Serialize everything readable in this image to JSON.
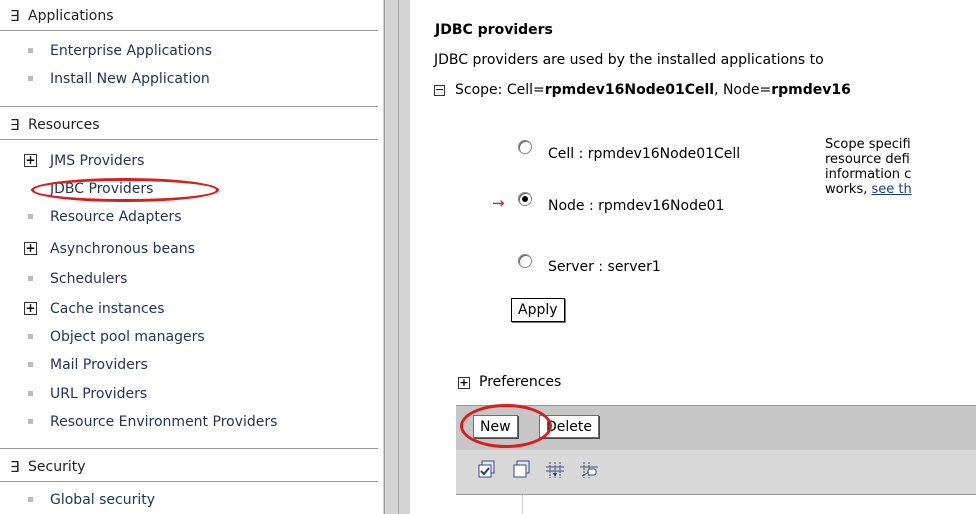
{
  "nav": {
    "sections": [
      {
        "label": "Applications",
        "expanded_glyph": "∃"
      },
      {
        "label": "Resources",
        "expanded_glyph": "∃"
      },
      {
        "label": "Security",
        "expanded_glyph": "∃"
      }
    ],
    "applications_items": [
      "Enterprise Applications",
      "Install New Application"
    ],
    "resources_items": [
      "JMS Providers",
      "JDBC Providers",
      "Resource Adapters",
      "Asynchronous beans",
      "Schedulers",
      "Cache instances",
      "Object pool managers",
      "Mail Providers",
      "URL Providers",
      "Resource Environment Providers"
    ],
    "security_items": [
      "Global security"
    ],
    "highlight_color": "#d81e1e"
  },
  "main": {
    "title": "JDBC providers",
    "description": "JDBC providers are used by the installed applications to",
    "scope": {
      "prefix": "Scope: Cell=",
      "cell": "rpmdev16Node01Cell",
      "sep": ", Node=",
      "node": "rpmdev16"
    },
    "radios": [
      {
        "label": "Cell : rpmdev16Node01Cell",
        "checked": false
      },
      {
        "label": "Node : rpmdev16Node01",
        "checked": true
      },
      {
        "label": "Server : server1",
        "checked": false
      }
    ],
    "help_lines": [
      "Scope specifi",
      "resource defi",
      "information c"
    ],
    "help_tail": "works, ",
    "help_link": "see th",
    "apply_label": "Apply",
    "preferences_label": "Preferences",
    "new_label": "New",
    "delete_label": "Delete",
    "toolbar_icons": [
      "select-all-icon",
      "deselect-all-icon",
      "show-filter-icon",
      "clear-filter-icon"
    ]
  }
}
